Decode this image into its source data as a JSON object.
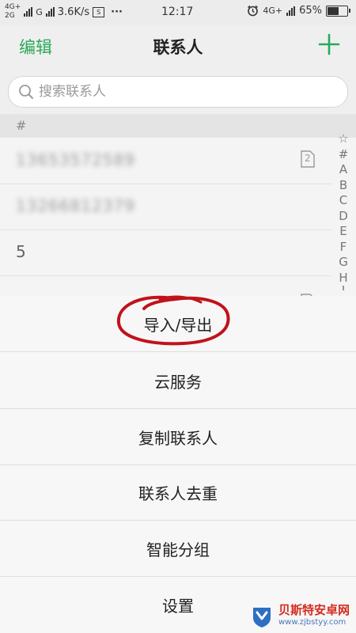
{
  "status_bar": {
    "sim1_network": "4G+",
    "sim1_type": "2G",
    "sim2_network": "G",
    "speed": "3.6K/s",
    "more": "···",
    "time": "12:17",
    "right_network": "4G+",
    "battery_percent": "65%",
    "battery_level": 0.65
  },
  "header": {
    "edit_label": "编辑",
    "title": "联系人",
    "add_icon": "plus-icon"
  },
  "search": {
    "placeholder": "搜索联系人"
  },
  "section": {
    "label": "#"
  },
  "contacts": [
    {
      "name": "13653572589",
      "sim_badge": "2"
    },
    {
      "name": "13266812379",
      "sim_badge": ""
    },
    {
      "name": "5",
      "sim_badge": ""
    },
    {
      "name": "",
      "sim_badge": ""
    }
  ],
  "index_letters": [
    "☆",
    "#",
    "A",
    "B",
    "C",
    "D",
    "E",
    "F",
    "G",
    "H",
    "I"
  ],
  "menu": {
    "items": [
      "导入/导出",
      "云服务",
      "复制联系人",
      "联系人去重",
      "智能分组",
      "设置"
    ]
  },
  "colors": {
    "accent": "#29a95a",
    "annotation": "#c1121c"
  },
  "watermark": {
    "name": "贝斯特安卓网",
    "url": "www.zjbstyy.com"
  }
}
